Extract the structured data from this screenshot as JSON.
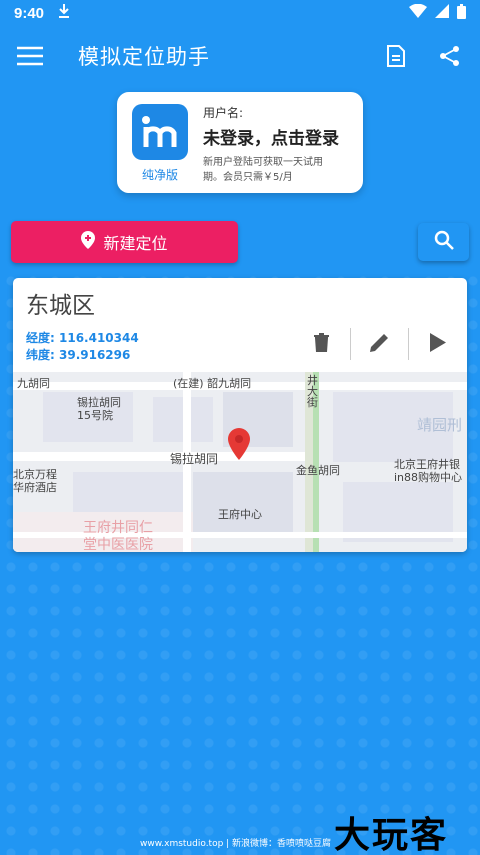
{
  "status": {
    "time": "9:40"
  },
  "appbar": {
    "title": "模拟定位助手"
  },
  "login": {
    "logo_sub": "纯净版",
    "label": "用户名:",
    "main": "未登录，点击登录",
    "desc_line1": "新用户登陆可获取一天试用",
    "desc_line2": "期。会员只需￥5/月"
  },
  "new_location_label": "新建定位",
  "location": {
    "district": "东城区",
    "longitude_label": "经度:",
    "longitude": "116.410344",
    "latitude_label": "纬度:",
    "latitude": "39.916296"
  },
  "map_labels": {
    "l1": "九胡同",
    "l2": "(在建) 韶九胡同",
    "l3": "井大街",
    "l4": "锡拉胡同",
    "l5": "15号院",
    "l6": "靖园刑",
    "l7": "北京万程",
    "l8": "华府酒店",
    "l9": "锡拉胡同",
    "l10": "金鱼胡同",
    "l11": "北京王府井银",
    "l12": "in88购物中心",
    "l13": "王府中心",
    "l14": "王府井同仁",
    "l15": "堂中医医院"
  },
  "footer": "www.xmstudio.top | 新浪微博：香喷喷哒豆腐",
  "watermark": "大玩客",
  "colors": {
    "primary": "#2196f3",
    "accent": "#ec1f63",
    "coords": "#1e88e5"
  }
}
